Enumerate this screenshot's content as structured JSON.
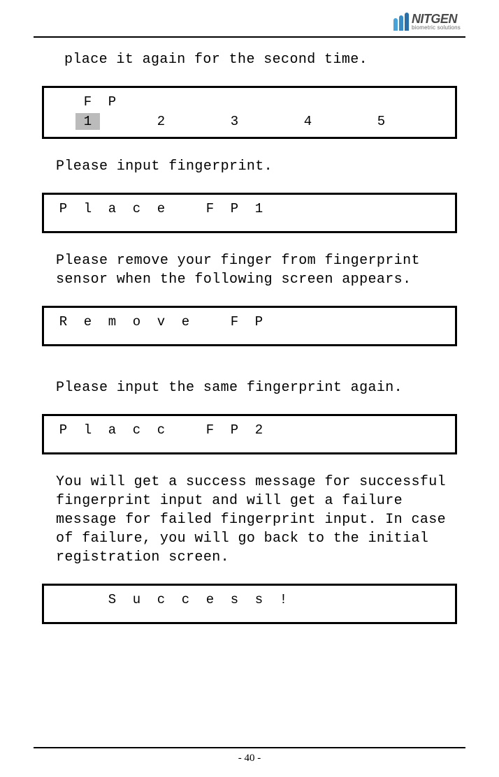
{
  "logo": {
    "name": "NITGEN",
    "tagline": "biometric solutions"
  },
  "intro": "place it again for the second time.",
  "box1": {
    "row1": [
      "",
      "F",
      "P",
      "",
      "",
      "",
      "",
      "",
      "",
      "",
      "",
      "",
      "",
      "",
      "",
      ""
    ],
    "row2": [
      "",
      "1",
      "",
      "",
      "2",
      "",
      "",
      "3",
      "",
      "",
      "4",
      "",
      "",
      "5",
      "",
      ""
    ],
    "highlight_index": 1
  },
  "instr1": "Please input fingerprint.",
  "box2": {
    "row1": [
      "P",
      "l",
      "a",
      "c",
      "e",
      "",
      "F",
      "P",
      "1",
      "",
      "",
      "",
      "",
      "",
      "",
      ""
    ]
  },
  "instr2": "Please remove your finger from fingerprint sensor when the following screen appears.",
  "box3": {
    "row1": [
      "R",
      "e",
      "m",
      "o",
      "v",
      "e",
      "",
      "F",
      "P",
      "",
      "",
      "",
      "",
      "",
      "",
      ""
    ]
  },
  "instr3": "Please input the same fingerprint again.",
  "box4": {
    "row1": [
      "P",
      "l",
      "a",
      "c",
      "c",
      "",
      "F",
      "P",
      "2",
      "",
      "",
      "",
      "",
      "",
      "",
      ""
    ]
  },
  "instr4": "You will get a success message for successful fingerprint input and will get a failure message for failed fingerprint input. In case of failure, you will go back to the initial registration screen.",
  "box5": {
    "row1": [
      "",
      "",
      "S",
      "u",
      "c",
      "c",
      "e",
      "s",
      "s",
      "!",
      "",
      "",
      "",
      "",
      "",
      ""
    ]
  },
  "page": "- 40 -"
}
